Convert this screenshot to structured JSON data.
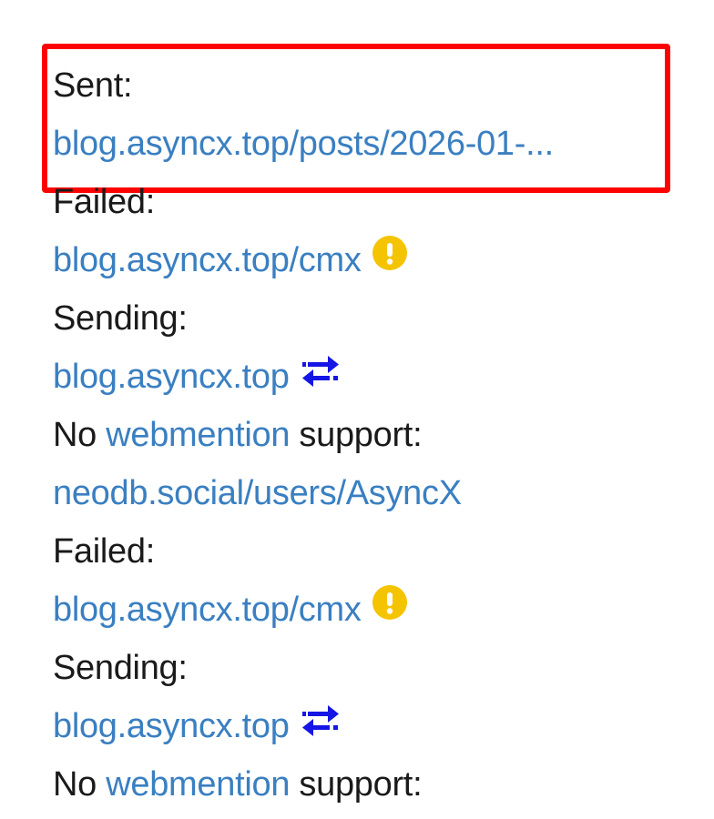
{
  "colors": {
    "link": "#3a7fc1",
    "text": "#1a1a1a",
    "highlight": "#ff0000",
    "warning": "#f5c400",
    "sending": "#1515e6"
  },
  "entries": [
    {
      "status": "Sent:",
      "link": "blog.asyncx.top/posts/2026-01-...",
      "icon": ""
    },
    {
      "status": "Failed:",
      "link": "blog.asyncx.top/cmx",
      "icon": "warning-icon"
    },
    {
      "status": "Sending:",
      "link": "blog.asyncx.top",
      "icon": "sync-arrows-icon"
    },
    {
      "status_prefix": "No",
      "status_link": "webmention",
      "status_suffix": "support:",
      "link": "neodb.social/users/AsyncX",
      "icon": ""
    },
    {
      "status": "Failed:",
      "link": "blog.asyncx.top/cmx",
      "icon": "warning-icon"
    },
    {
      "status": "Sending:",
      "link": "blog.asyncx.top",
      "icon": "sync-arrows-icon"
    },
    {
      "status_prefix": "No",
      "status_link": "webmention",
      "status_suffix": "support:"
    }
  ]
}
